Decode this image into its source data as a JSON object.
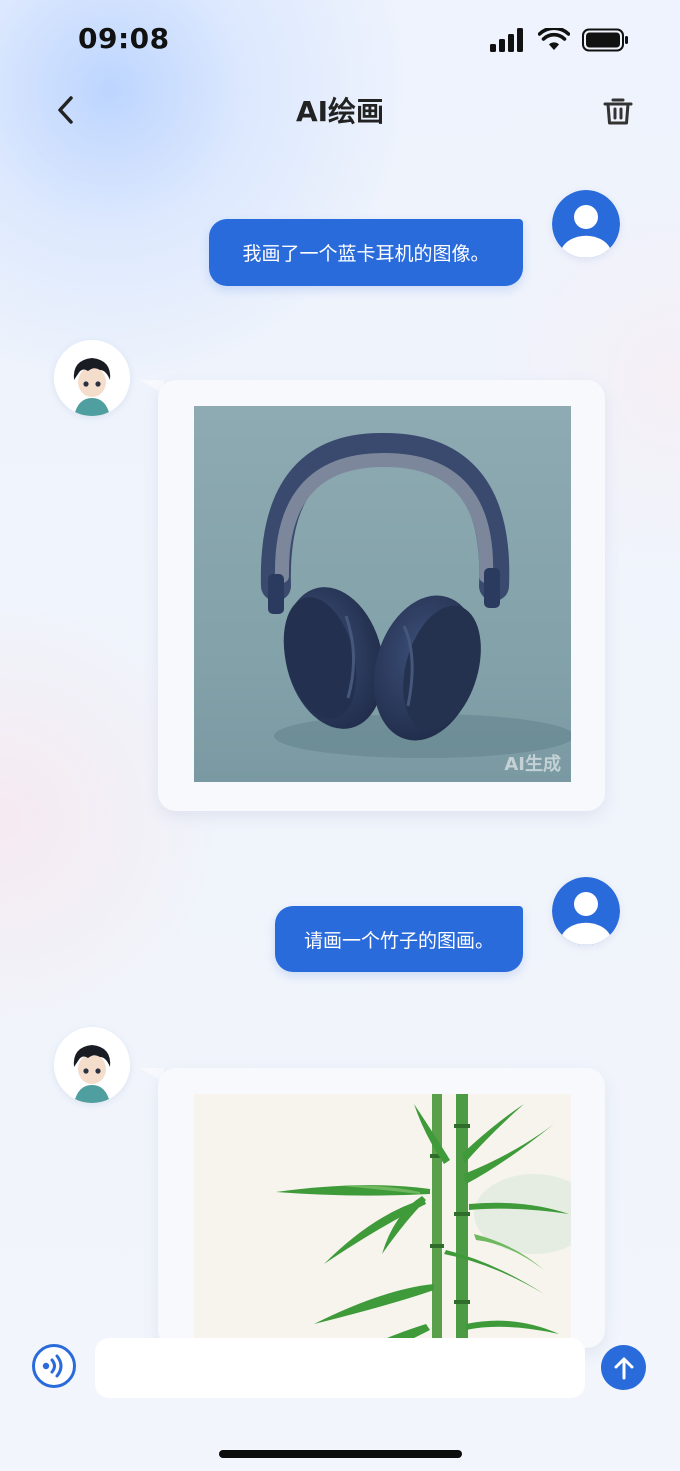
{
  "status_bar": {
    "time": "09:08"
  },
  "header": {
    "title": "AI绘画"
  },
  "messages": [
    {
      "role": "user",
      "text": "我画了一个蓝卡耳机的图像。"
    },
    {
      "role": "bot",
      "image": "headphones-image",
      "watermark": "AI生成"
    },
    {
      "role": "user",
      "text": "请画一个竹子的图画。"
    },
    {
      "role": "bot",
      "image": "bamboo-image"
    }
  ],
  "input": {
    "value": "",
    "placeholder": ""
  },
  "colors": {
    "accent": "#2a6bdb",
    "user_bubble": "#2a6bdb",
    "card_bg": "#f7f9fd"
  }
}
